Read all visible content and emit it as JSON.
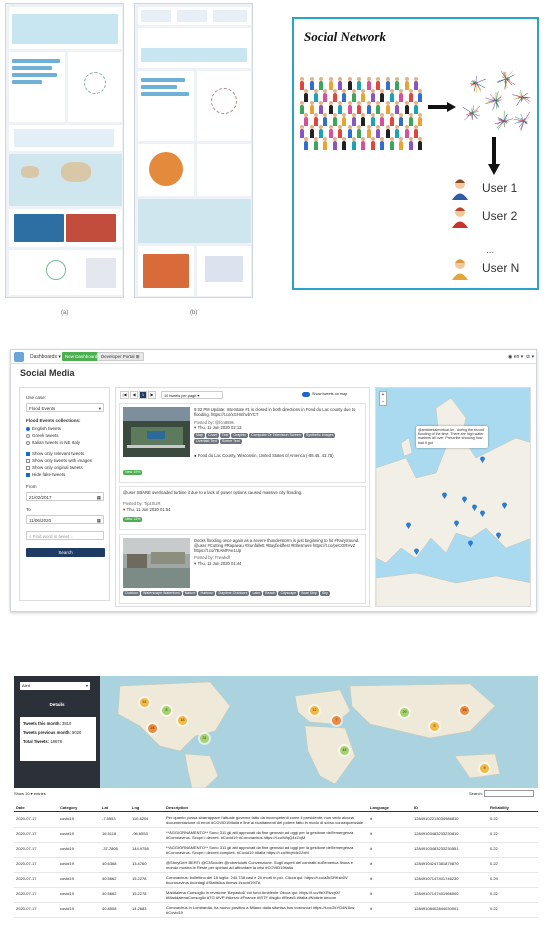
{
  "labels": {
    "a": "(a)",
    "b": "(b)"
  },
  "social_network": {
    "title": "Social Network",
    "users": [
      "User 1",
      "User 2",
      "User N"
    ],
    "ellipsis": "..."
  },
  "app": {
    "nav": {
      "dashboards": "Dashboards ▾",
      "new_dashboard": "New Dashboard",
      "developer_portal": "Developer Portal ⊞",
      "user": "◉ en ▾",
      "help": "⊘ ▾"
    },
    "title": "Social Media",
    "sidebar": {
      "use_case_label": "Use case:",
      "use_case_value": "Flood Events",
      "collections_label": "Flood Events collections:",
      "collections": [
        {
          "label": "English tweets",
          "selected": true
        },
        {
          "label": "Greek tweets",
          "selected": false
        },
        {
          "label": "Italian tweets in NE Italy",
          "selected": false
        }
      ],
      "filters": [
        {
          "label": "Show only relevant tweets",
          "checked": true
        },
        {
          "label": "Show only tweets with images",
          "checked": false
        },
        {
          "label": "Show only original tweets",
          "checked": false
        },
        {
          "label": "Hide fake tweets",
          "checked": true
        }
      ],
      "from_label": "From",
      "from_value": "21/02/2017",
      "to_label": "To",
      "to_value": "11/06/2020",
      "search_placeholder": "Find word in tweet...",
      "search_button": "Search"
    },
    "feed": {
      "pages": [
        "|◀",
        "◀",
        "1",
        "▶"
      ],
      "per_page": "10 tweets per page",
      "show_on_map": "Show tweets on map",
      "tweets": [
        {
          "text": "9:32 PM Update: Interstate #1 is closed in both directions in Fond du Lac county due to flooding. https://t.co/xGHmhvbYCT",
          "posted_by": "Posted by: @fcn889s",
          "date": "Thu, 11 Jun 2020 02:13",
          "tags": [
            "Map",
            "Chart",
            "Text",
            "Graphic",
            "Computer Or Television Screen",
            "Synthetic Images",
            "Overlaid Text",
            "Scene Text"
          ],
          "location": "Fond du Lac County, Wisconsin, United States of America (-88.45, 43.75)",
          "badge": "New 19%"
        },
        {
          "text": "@user SBARE overloaded turbine it due to a lack of power options caused massive city flooding.",
          "posted_by": "Posted by: TipzSUR",
          "date": "Thu, 11 Jun 2020 01:54",
          "badge": "New 13%"
        },
        {
          "text": "Docks flooding once again as a severe thunderstorm is just beginning to hit #FairySound. @user #Cutting #Rapaeau #Sunfallett #Bayfieldfest #Ellesmere https://t.co/peCGRHvZ https://t.co/7EAMPAe1Up",
          "posted_by": "Posted by: Frewkdf",
          "date": "Thu, 11 Jun 2020 01:44",
          "tags": [
            "Outdoor",
            "Waterscape Waterfront",
            "Nature",
            "Harbour",
            "Daytime Outdoors",
            "Lake",
            "Beach",
            "Cityscape",
            "Boat Ship",
            "Sky"
          ]
        }
      ]
    },
    "map": {
      "zoom_in": "+",
      "zoom_out": "−",
      "popup": "@ambientalevirtual An . during the record flooding of the time. There are high water markers all over. Prescribe showing how bad it got"
    }
  },
  "dashboard": {
    "dropdown": "Alert",
    "details_title": "Details",
    "stats": [
      {
        "label": "Tweets this month:",
        "value": "3810"
      },
      {
        "label": "Tweets previous month:",
        "value": "5020"
      },
      {
        "label": "Total Tweets:",
        "value": "18678"
      }
    ],
    "clusters": [
      "51",
      "8",
      "18",
      "24",
      "31",
      "12",
      "7",
      "29",
      "5",
      "16",
      "44",
      "9"
    ],
    "show_entries": "Show 10 ▾ entries",
    "search_label": "Search:",
    "columns": [
      "Date",
      "Category",
      "Lat",
      "Lng",
      "Description",
      "Language",
      "ID",
      "Reliability"
    ],
    "rows": [
      [
        "2020-07-17",
        "covid19",
        "-7.5553",
        "110.8204",
        "Per quanto possa sbarrappare l'attuale governo fatto da incompetenti come il presidente, non vedo alcuna documentazione di errori #COVID19Italia e fine ai ricattamenti del potere fatto in modo di sorso consequenziale",
        "it",
        "12849102213034986810",
        "0.22"
      ],
      [
        "2020-07-17",
        "covid19",
        "16.5118",
        "-96.6553",
        "**AGGIORNAMENTO** Sono 311 gli atti approvati da fine gennaio ad oggi per la gestione dell'emergenza #Coronavirus. Scopri i decreti. #Covid19 #Coronavirus https://t.co/WqQ4zZxjM",
        "it",
        "12849103483233230810",
        "0.22"
      ],
      [
        "2020-07-17",
        "covid19",
        "-37.7805",
        "144.9758",
        "**AGGIORNAMENTO** Sono 311 gli atti approvati da fine gennaio ad oggi per la gestione dell'emergenza #Coronavirus. Scopri i decreti completi. #Covid19 #Italia https://t.co/9fqHdz2ZxM",
        "it",
        "12849103483233230551",
        "0.22"
      ],
      [
        "2020-07-17",
        "covid19",
        "40.6368",
        "13.4760",
        "@StoryDeH BERTI @C3Scoder @robertolotti Convenzione. Sugli ospeti dei contratti sull'emerica finora e mondo mostra le Reste per spiriani ad affrontare la crisi #COVID19italia",
        "it",
        "12849104247381879870",
        "0.22"
      ],
      [
        "2020-07-17",
        "covid19",
        "40.5662",
        "15.2278",
        "Coronavirus: bollettino del 18 luglio: 240.738 casi e 20 morti in più. Clicca qui: https://t.co/aJkSRKsb0V #coronavirus #contagi #Statistica #news #covid19ITA",
        "it",
        "12849107147401746230",
        "0.29"
      ],
      [
        "2020-07-17",
        "covid19",
        "40.5662",
        "15.2278",
        "Maddalena Consoglio in revisione 'Bepasto6' cul fond Ambiente Clicca qui: https://t.co/9eXRtzcjtXf #MaddalenaConsoglio #TG #IVP #Aterzo #Fnance #ISTF #Isglio #Reas5 #Italia #Notizie #ecom",
        "it",
        "12849107147401966000",
        "0.22"
      ],
      [
        "2020-07-17",
        "covid19",
        "40.8508",
        "14.2683",
        "Coronavirus in Lombardia, ha nuovo positivo a Milano dalla sitonisa bos vostruvori https://t.co/2kYD4N1kw #Covid19",
        "it",
        "12849108402844030001",
        "0.22"
      ]
    ]
  }
}
